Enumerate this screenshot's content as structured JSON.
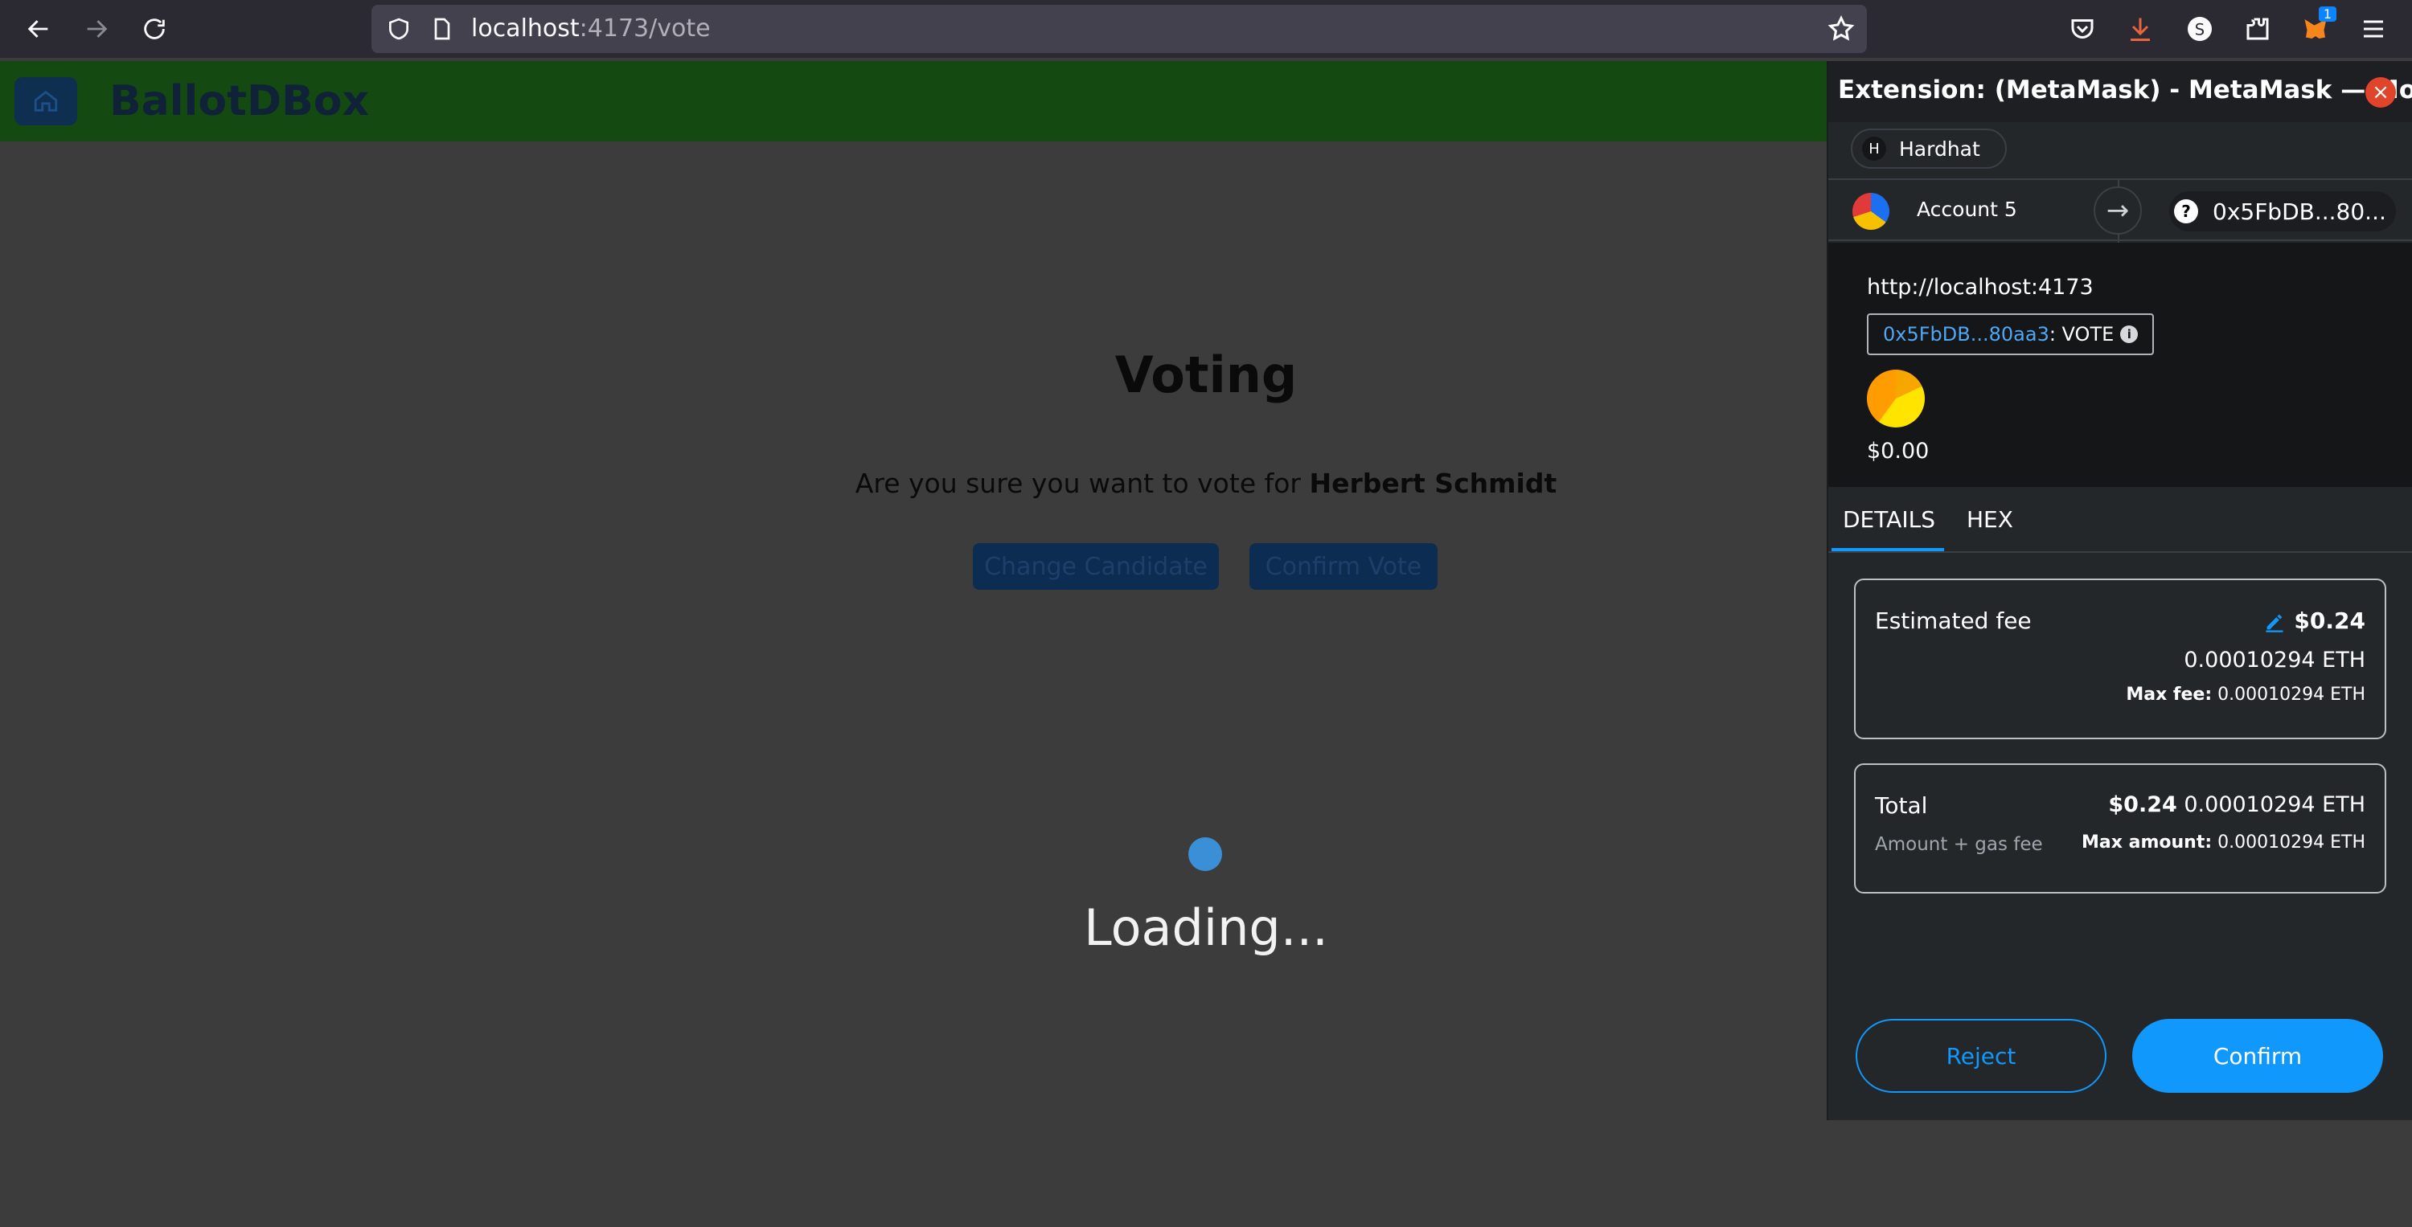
{
  "browser": {
    "url_host": "localhost",
    "url_rest": ":4173/vote",
    "extension_badge": "1"
  },
  "page": {
    "brand": "BallotDBox",
    "title": "Voting",
    "prompt_prefix": "Are you sure you want to vote for ",
    "candidate": "Herbert Schmidt",
    "change_candidate_label": "Change Candidate",
    "confirm_vote_label": "Confirm Vote",
    "loading_text": "Loading..."
  },
  "metamask": {
    "window_title": "Extension: (MetaMask) - MetaMask — Mozil...",
    "network_initial": "H",
    "network_label": "Hardhat",
    "account_name": "Account 5",
    "to_address": "0x5FbDB...80...",
    "origin_url": "http://localhost:4173",
    "contract_address": "0x5FbDB...80aa3",
    "method_suffix": " : VOTE",
    "token_value": "$0.00",
    "tabs": [
      "DETAILS",
      "HEX"
    ],
    "estimated_fee_label": "Estimated fee",
    "estimated_fee_usd": "$0.24",
    "estimated_fee_eth": "0.00010294 ETH",
    "max_fee_label": "Max fee:",
    "max_fee_value": "0.00010294 ETH",
    "total_label": "Total",
    "total_usd": "$0.24",
    "total_eth": "0.00010294 ETH",
    "total_sub": "Amount + gas fee",
    "max_amount_label": "Max amount:",
    "max_amount_value": "0.00010294 ETH",
    "reject_label": "Reject",
    "confirm_label": "Confirm"
  },
  "colors": {
    "accent": "#1098fc",
    "header_green": "#144a12",
    "close_red": "#e0452b"
  }
}
